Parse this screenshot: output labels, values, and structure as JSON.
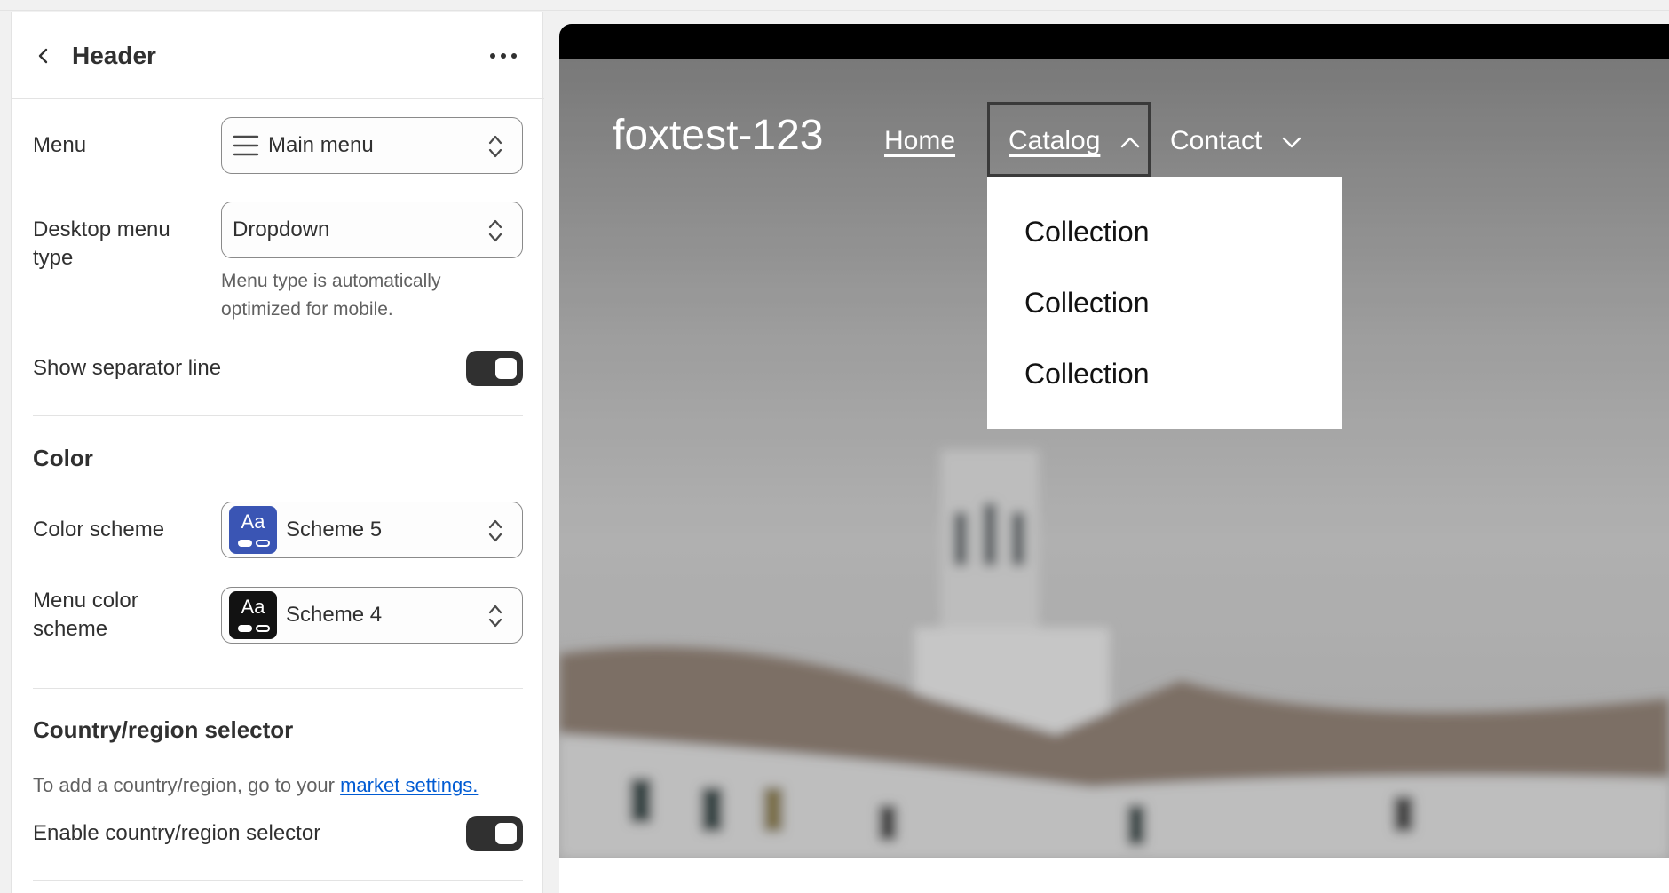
{
  "sidebar": {
    "title": "Header",
    "menu_label": "Menu",
    "menu_value": "Main menu",
    "desktop_menu_type_label_line1": "Desktop menu",
    "desktop_menu_type_label_line2": "type",
    "desktop_menu_type_value": "Dropdown",
    "menu_type_help_line1": "Menu type is automatically",
    "menu_type_help_line2": "optimized for mobile.",
    "separator_label": "Show separator line",
    "separator_on": true,
    "color_section_title": "Color",
    "color_scheme_label": "Color scheme",
    "color_scheme_value": "Scheme 5",
    "color_scheme_swatch": "#3a55b4",
    "menu_color_scheme_label_line1": "Menu color",
    "menu_color_scheme_label_line2": "scheme",
    "menu_color_scheme_value": "Scheme 4",
    "menu_color_scheme_swatch": "#121212",
    "swatch_text": "Aa",
    "country_section_title": "Country/region selector",
    "country_help_prefix": "To add a country/region, go to your ",
    "country_help_link": "market settings.",
    "country_selector_label": "Enable country/region selector",
    "country_selector_on": true
  },
  "preview": {
    "brand": "foxtest-123",
    "nav": [
      "Home",
      "Catalog",
      "Contact"
    ],
    "dropdown_items": [
      "Collection",
      "Collection",
      "Collection"
    ]
  },
  "colors": {
    "accent_link": "#005bd3",
    "toggle_on": "#303030",
    "announcement_bar": "#000000"
  }
}
